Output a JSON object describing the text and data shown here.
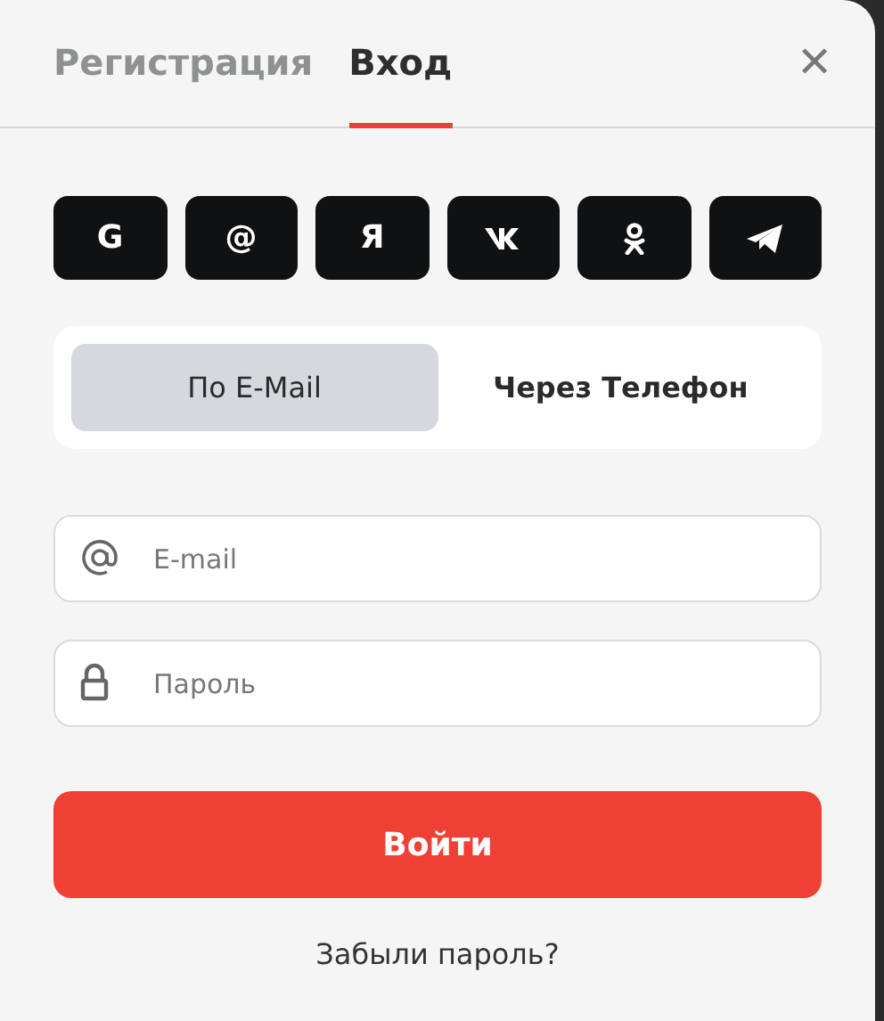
{
  "tabs": [
    {
      "label": "Регистрация",
      "selected": false
    },
    {
      "label": "Вход",
      "selected": true
    }
  ],
  "close": {
    "glyph": "✕"
  },
  "socials": [
    {
      "kind": "glyph",
      "glyph": "G"
    },
    {
      "kind": "glyph",
      "glyph": "@"
    },
    {
      "kind": "glyph",
      "glyph": "Я"
    },
    {
      "kind": "logo"
    },
    {
      "kind": "person"
    },
    {
      "kind": "plane"
    }
  ],
  "methods": [
    {
      "label": "По E-Mail",
      "selected": true
    },
    {
      "label": "Через Телефон",
      "selected": false
    }
  ],
  "fields": [
    {
      "kind": "email",
      "placeholder": "E-mail"
    },
    {
      "kind": "password",
      "placeholder": "Пароль"
    }
  ],
  "submit": "Войти",
  "forgot": "Забыли пароль?"
}
